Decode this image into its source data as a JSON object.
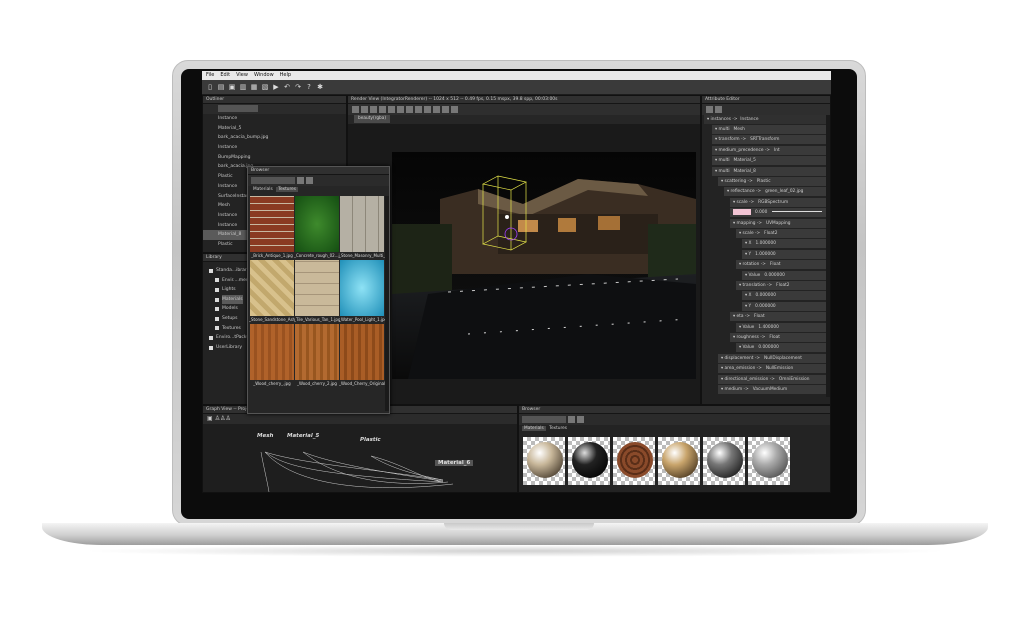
{
  "menu": [
    "File",
    "Edit",
    "View",
    "Window",
    "Help"
  ],
  "toolbar_icons": [
    "new-file-icon",
    "open-folder-icon",
    "save-icon",
    "render-settings-icon",
    "render-region-icon",
    "import-icon",
    "render-icon",
    "undo-icon",
    "redo-icon",
    "help-icon",
    "bug-icon"
  ],
  "outliner": {
    "title": "Outliner",
    "items": [
      "Instance",
      "Material_5",
      "bark_acacia_bump.jpg",
      "Instance",
      "BumpMapping",
      "bark_acacia.jpg",
      "Plastic",
      "Instance",
      "SurfaceInstance",
      "Mesh",
      "Instance",
      "Instance",
      "Material_8",
      "Plastic"
    ]
  },
  "library": {
    "title": "Library",
    "items": [
      "Standa...ibrary",
      "Envir....ments",
      "Lights",
      "Materials",
      "Models",
      "Setups",
      "Textures",
      "Enviro...tPack0",
      "UserLibrary"
    ],
    "selected": "Materials"
  },
  "floating_browser": {
    "title": "Browser",
    "tabs": [
      "Materials",
      "Textures"
    ],
    "thumbs": [
      "_Brick_Antique_1.jpg",
      "_Concrete_rough_02...jpg",
      "_Stone_Masonry_Multi_1",
      "_Stone_Sandstone_Ashlar",
      "_Tile_Various_Tan_1.jpg",
      "_Water_Pool_Light_1.jpg",
      "_Wood_cherry_.jpg",
      "_Wood_cherry_2.jpg",
      "_Wood_Cherry_Original_"
    ]
  },
  "render_view": {
    "title": "Render View (IntegratorRenderer) -- 1024 x 512 -- 0.49 fps, 0.15 mspx, 39.8 spp, 00:03:00s",
    "tab": "beauty(rgba)"
  },
  "attribute_editor": {
    "title": "Attribute Editor",
    "root": "instances ->",
    "root_value": "Instance",
    "rows": [
      {
        "k": "multi",
        "v": "Mesh"
      },
      {
        "k": "transform ->",
        "v": "SRTTransform"
      },
      {
        "k": "medium_precedence ->",
        "v": "Int"
      },
      {
        "k": "multi",
        "v": "Material_5"
      },
      {
        "k": "multi",
        "v": "Material_8"
      },
      {
        "k": "scattering ->",
        "v": "Plastic"
      },
      {
        "k": "reflectance ->",
        "v": "green_leaf_02.jpg"
      },
      {
        "k": "scale ->",
        "v": "RGBSpectrum"
      },
      {
        "k": "",
        "v": "0.000"
      },
      {
        "k": "mapping ->",
        "v": "UVMapping"
      },
      {
        "k": "scale ->",
        "v": "Float2"
      },
      {
        "k": "X",
        "v": "1.000000"
      },
      {
        "k": "Y",
        "v": "1.000000"
      },
      {
        "k": "rotation ->",
        "v": "Float"
      },
      {
        "k": "Value",
        "v": "0.000000"
      },
      {
        "k": "translation ->",
        "v": "Float2"
      },
      {
        "k": "X",
        "v": "0.000000"
      },
      {
        "k": "Y",
        "v": "0.000000"
      },
      {
        "k": "eta ->",
        "v": "Float"
      },
      {
        "k": "Value",
        "v": "1.400000"
      },
      {
        "k": "roughness ->",
        "v": "Float"
      },
      {
        "k": "Value",
        "v": "0.000000"
      },
      {
        "k": "displacement ->",
        "v": "NullDisplacement"
      },
      {
        "k": "area_emission ->",
        "v": "NullEmission"
      },
      {
        "k": "directional_emission ->",
        "v": "OmniEmission"
      },
      {
        "k": "medium ->",
        "v": "VacuumMedium"
      }
    ]
  },
  "graph_view": {
    "title": "Graph View -- ProjectFile",
    "nodes": [
      "Mesh",
      "Material_5",
      "Plastic",
      "Material_6"
    ]
  },
  "browser": {
    "title": "Browser",
    "tabs": [
      "Materials",
      "Textures"
    ]
  },
  "colors": {
    "accent": "#6f6f6f",
    "selection": "#5a5a5a",
    "swatch": "#f2c4d4"
  }
}
